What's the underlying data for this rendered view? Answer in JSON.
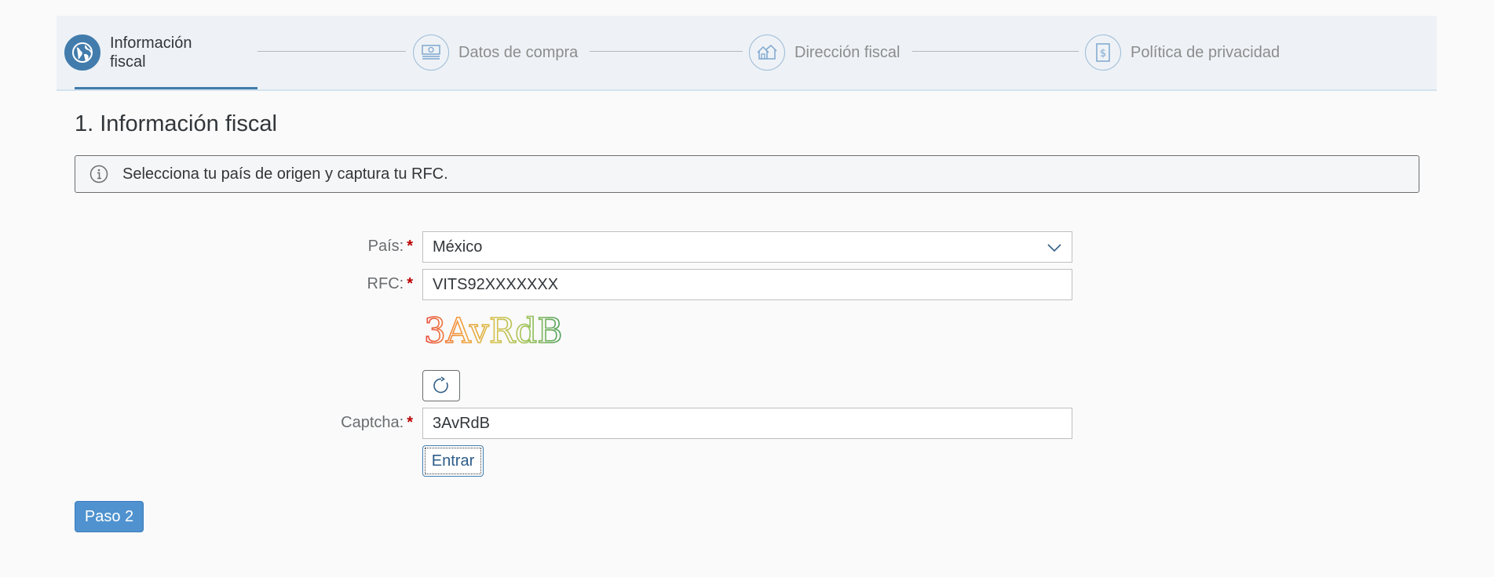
{
  "wizard": {
    "steps": [
      {
        "label": "Información fiscal",
        "icon": "globe-icon",
        "active": true
      },
      {
        "label": "Datos de compra",
        "icon": "money-bill-icon",
        "active": false
      },
      {
        "label": "Dirección fiscal",
        "icon": "houses-icon",
        "active": false
      },
      {
        "label": "Política de privacidad",
        "icon": "document-dollar-icon",
        "active": false
      }
    ]
  },
  "page": {
    "title": "1. Información fiscal"
  },
  "info": {
    "icon": "info-circle-icon",
    "text": "Selecciona tu país de origen y captura tu RFC."
  },
  "form": {
    "country": {
      "label": "País:",
      "required_mark": "*",
      "value": "México",
      "icon": "chevron-down-icon"
    },
    "rfc": {
      "label": "RFC:",
      "required_mark": "*",
      "value": "VITS92XXXXXXX"
    },
    "captcha_image_text": "3AvRdB",
    "refresh_icon": "refresh-icon",
    "captcha": {
      "label": "Captcha:",
      "required_mark": "*",
      "value": "3AvRdB"
    },
    "enter_button": "Entrar"
  },
  "footer": {
    "next_button": "Paso 2"
  },
  "colors": {
    "accent": "#427cac",
    "required": "#bb0000",
    "primary_button": "#4f92cf"
  }
}
